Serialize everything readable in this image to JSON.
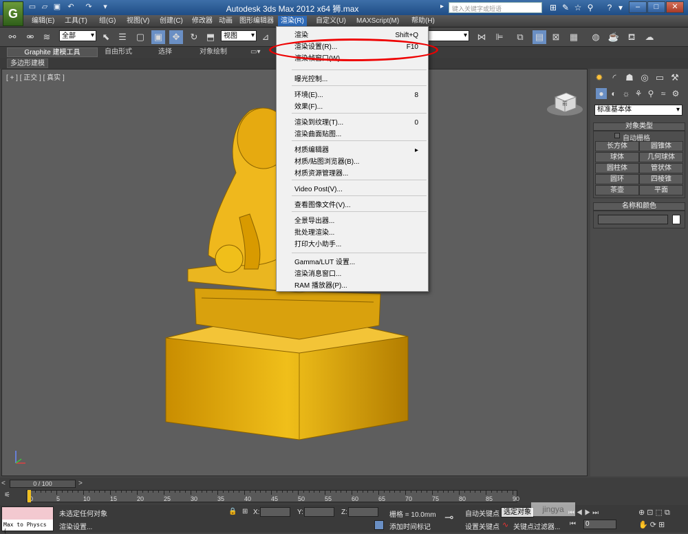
{
  "titlebar": {
    "title": "Autodesk 3ds Max  2012 x64     狮.max",
    "search_placeholder": "键入关键字或短语"
  },
  "menubar": {
    "items": [
      "编辑(E)",
      "工具(T)",
      "组(G)",
      "视图(V)",
      "创建(C)",
      "修改器",
      "动画",
      "图形编辑器",
      "渲染(R)",
      "自定义(U)",
      "MAXScript(M)",
      "帮助(H)"
    ]
  },
  "toolbar": {
    "selection_filter": "全部",
    "ref_coord": "视图"
  },
  "ribbon": {
    "tabs": [
      "Graphite 建模工具",
      "自由形式",
      "选择",
      "对象绘制"
    ],
    "sub_label": "多边形建模"
  },
  "viewport": {
    "label": "[ + ] [ 正交 ] [ 真实 ]",
    "viewcube_label": "前"
  },
  "render_menu": {
    "items": [
      {
        "label": "渲染",
        "shortcut": "Shift+Q"
      },
      {
        "label": "渲染设置(R)...",
        "shortcut": "F10"
      },
      {
        "label": "渲染帧窗口(W)",
        "shortcut": ""
      },
      {
        "label": "曝光控制...",
        "shortcut": ""
      },
      {
        "label": "环境(E)...",
        "shortcut": "8"
      },
      {
        "label": "效果(F)...",
        "shortcut": ""
      },
      {
        "label": "渲染到纹理(T)...",
        "shortcut": "0"
      },
      {
        "label": "渲染曲面贴图...",
        "shortcut": ""
      },
      {
        "label": "材质编辑器",
        "shortcut": "▸"
      },
      {
        "label": "材质/贴图浏览器(B)...",
        "shortcut": ""
      },
      {
        "label": "材质资源管理器...",
        "shortcut": ""
      },
      {
        "label": "Video Post(V)...",
        "shortcut": ""
      },
      {
        "label": "查看图像文件(V)...",
        "shortcut": ""
      },
      {
        "label": "全景导出器...",
        "shortcut": ""
      },
      {
        "label": "批处理渲染...",
        "shortcut": ""
      },
      {
        "label": "打印大小助手...",
        "shortcut": ""
      },
      {
        "label": "Gamma/LUT 设置...",
        "shortcut": ""
      },
      {
        "label": "渲染消息窗口...",
        "shortcut": ""
      },
      {
        "label": "RAM 播放器(P)...",
        "shortcut": ""
      }
    ]
  },
  "command_panel": {
    "category": "标准基本体",
    "object_type_title": "对象类型",
    "autogrid_label": "自动栅格",
    "buttons": [
      "长方体",
      "圆锥体",
      "球体",
      "几何球体",
      "圆柱体",
      "管状体",
      "圆环",
      "四棱锥",
      "茶壶",
      "平面"
    ],
    "name_color_title": "名称和颜色"
  },
  "timeline": {
    "frame_indicator": "0 / 100",
    "ticks": [
      "0",
      "5",
      "10",
      "15",
      "20",
      "25",
      "30",
      "35",
      "40",
      "45",
      "50",
      "55",
      "60",
      "65",
      "70",
      "75",
      "80",
      "85",
      "90"
    ]
  },
  "statusbar": {
    "script_text": "Max to Physcs (",
    "status_line1": "未选定任何对象",
    "status_line2": "渲染设置...",
    "x_label": "X:",
    "y_label": "Y:",
    "z_label": "Z:",
    "grid_text": "栅格 = 10.0mm",
    "add_time_tag": "添加时间标记",
    "auto_key": "自动关键点",
    "set_key": "设置关键点",
    "selected_object": "选定对象",
    "key_filters": "关键点过滤器...",
    "frame_value": "0",
    "watermark": "jingya"
  },
  "colors": {
    "accent": "#2e6ab8",
    "highlight_ring": "#e00000",
    "model": "#e0a800"
  }
}
